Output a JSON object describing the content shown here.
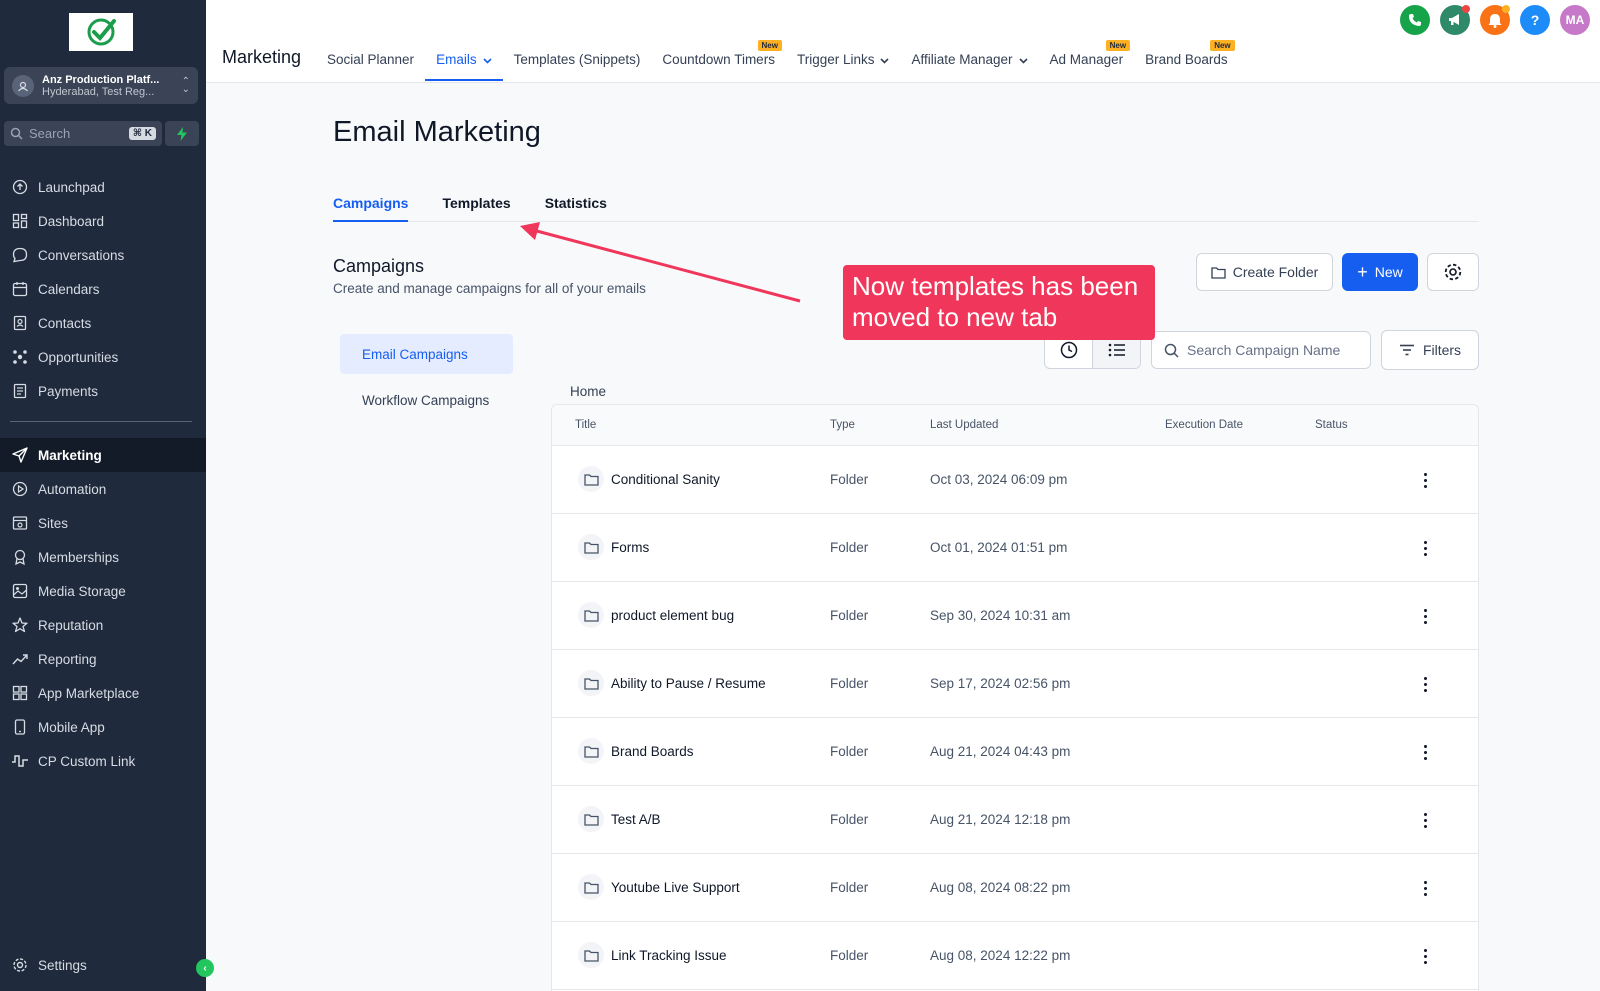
{
  "colors": {
    "sidebar_bg": "#1f2a3c",
    "accent": "#155eef",
    "annotation": "#f0365a",
    "success": "#22c55e"
  },
  "sidebar": {
    "account": {
      "name": "Anz Production Platf...",
      "location": "Hyderabad, Test Reg..."
    },
    "search": {
      "placeholder": "Search",
      "shortcut": "⌘ K"
    },
    "items": [
      {
        "label": "Launchpad",
        "icon": "launchpad-icon"
      },
      {
        "label": "Dashboard",
        "icon": "dashboard-icon"
      },
      {
        "label": "Conversations",
        "icon": "chat-icon"
      },
      {
        "label": "Calendars",
        "icon": "calendar-icon"
      },
      {
        "label": "Contacts",
        "icon": "contacts-icon"
      },
      {
        "label": "Opportunities",
        "icon": "opportunities-icon"
      },
      {
        "label": "Payments",
        "icon": "payments-icon"
      }
    ],
    "items2": [
      {
        "label": "Marketing",
        "icon": "send-icon",
        "active": true
      },
      {
        "label": "Automation",
        "icon": "automation-icon"
      },
      {
        "label": "Sites",
        "icon": "sites-icon"
      },
      {
        "label": "Memberships",
        "icon": "memberships-icon"
      },
      {
        "label": "Media Storage",
        "icon": "image-icon"
      },
      {
        "label": "Reputation",
        "icon": "star-icon"
      },
      {
        "label": "Reporting",
        "icon": "chart-icon"
      },
      {
        "label": "App Marketplace",
        "icon": "grid-icon"
      },
      {
        "label": "Mobile App",
        "icon": "phone-icon"
      },
      {
        "label": "CP Custom Link",
        "icon": "link-icon"
      }
    ],
    "settings_label": "Settings"
  },
  "topbar": {
    "title": "Marketing",
    "nav": [
      {
        "label": "Social Planner",
        "badge": ""
      },
      {
        "label": "Emails",
        "badge": "",
        "active": true,
        "dropdown": true
      },
      {
        "label": "Templates (Snippets)",
        "badge": ""
      },
      {
        "label": "Countdown Timers",
        "badge": "New"
      },
      {
        "label": "Trigger Links",
        "badge": "",
        "dropdown": true
      },
      {
        "label": "Affiliate Manager",
        "badge": "",
        "dropdown": true
      },
      {
        "label": "Ad Manager",
        "badge": "New"
      },
      {
        "label": "Brand Boards",
        "badge": "New"
      }
    ],
    "avatar_initials": "MA"
  },
  "main": {
    "page_title": "Email Marketing",
    "tabs": [
      "Campaigns",
      "Templates",
      "Statistics"
    ],
    "section_title": "Campaigns",
    "section_subtitle": "Create and manage campaigns for all of your emails",
    "create_folder_label": "Create Folder",
    "new_label": "New",
    "filters_label": "Filters",
    "search_placeholder": "Search Campaign Name",
    "left_menu": [
      "Email Campaigns",
      "Workflow Campaigns"
    ],
    "breadcrumb": "Home",
    "table": {
      "columns": [
        "Title",
        "Type",
        "Last Updated",
        "Execution Date",
        "Status"
      ],
      "rows": [
        {
          "title": "Conditional Sanity",
          "type": "Folder",
          "updated": "Oct 03, 2024 06:09 pm"
        },
        {
          "title": "Forms",
          "type": "Folder",
          "updated": "Oct 01, 2024 01:51 pm"
        },
        {
          "title": "product element bug",
          "type": "Folder",
          "updated": "Sep 30, 2024 10:31 am"
        },
        {
          "title": "Ability to Pause / Resume",
          "type": "Folder",
          "updated": "Sep 17, 2024 02:56 pm"
        },
        {
          "title": "Brand Boards",
          "type": "Folder",
          "updated": "Aug 21, 2024 04:43 pm"
        },
        {
          "title": "Test A/B",
          "type": "Folder",
          "updated": "Aug 21, 2024 12:18 pm"
        },
        {
          "title": "Youtube Live Support",
          "type": "Folder",
          "updated": "Aug 08, 2024 08:22 pm"
        },
        {
          "title": "Link Tracking Issue",
          "type": "Folder",
          "updated": "Aug 08, 2024 12:22 pm"
        }
      ]
    }
  },
  "annotation": {
    "text_line1": "Now templates has been",
    "text_line2": "moved to new tab"
  }
}
